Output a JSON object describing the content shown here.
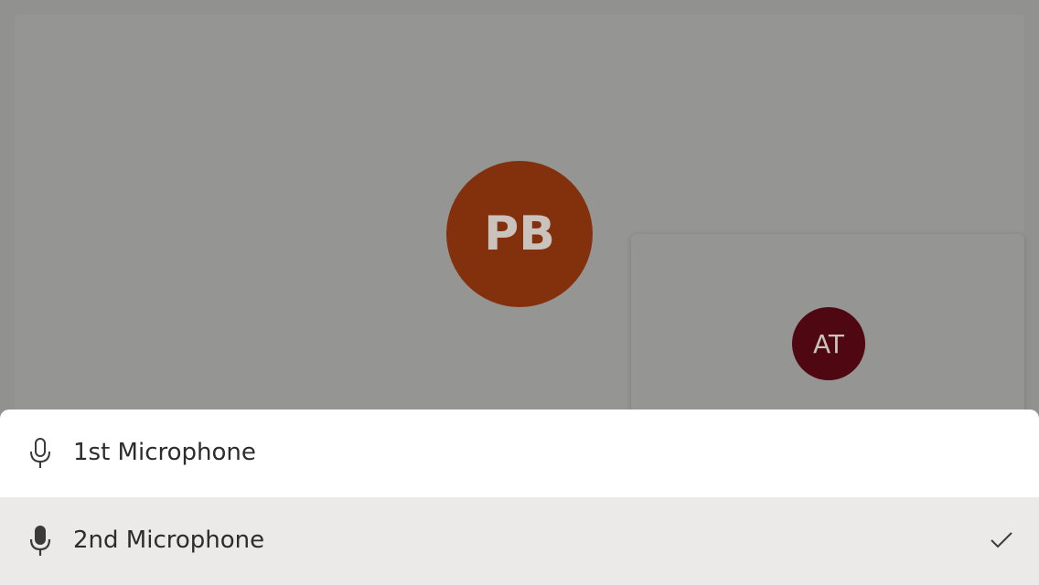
{
  "participants": {
    "main": {
      "initials": "PB",
      "color": "#83310c"
    },
    "self": {
      "initials": "AT",
      "color": "#4f0711"
    }
  },
  "microphone_menu": {
    "options": [
      {
        "label": "1st Microphone",
        "icon": "microphone-outline-icon",
        "selected": false
      },
      {
        "label": "2nd Microphone",
        "icon": "microphone-filled-icon",
        "selected": true
      }
    ],
    "selected_indicator_icon": "checkmark-icon"
  },
  "colors": {
    "overlay_background": "#919190",
    "sheet_background": "#ffffff",
    "selected_row_background": "#ebeae9"
  }
}
